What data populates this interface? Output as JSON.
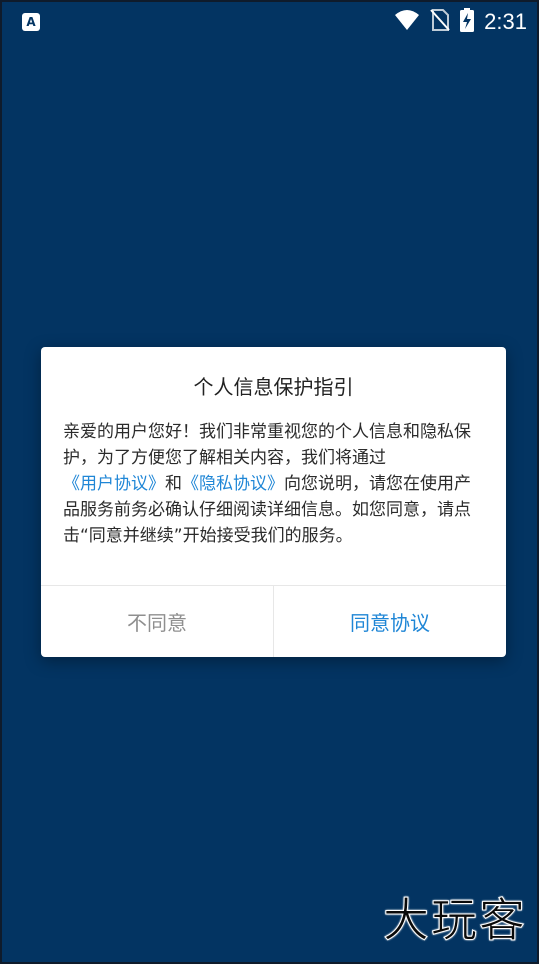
{
  "status_bar": {
    "app_badge": "A",
    "time": "2:31",
    "icons": [
      "wifi-icon",
      "no-sim-icon",
      "battery-charging-icon"
    ]
  },
  "dialog": {
    "title": "个人信息保护指引",
    "body": {
      "part1": "亲爱的用户您好！我们非常重视您的个人信息和隐私保护，为了方便您了解相关内容，我们将通过",
      "user_agreement_link": "《用户协议》",
      "and": "和",
      "privacy_link": "《隐私协议》",
      "part2": "向您说明，请您在使用产品服务前务必确认仔细阅读详细信息。如您同意，请点击“同意并继续”开始接受我们的服务。"
    },
    "decline_label": "不同意",
    "accept_label": "同意协议"
  },
  "colors": {
    "background": "#033462",
    "link": "#1f86d6",
    "decline_text": "#8f8f8f"
  },
  "watermark": "大玩客"
}
